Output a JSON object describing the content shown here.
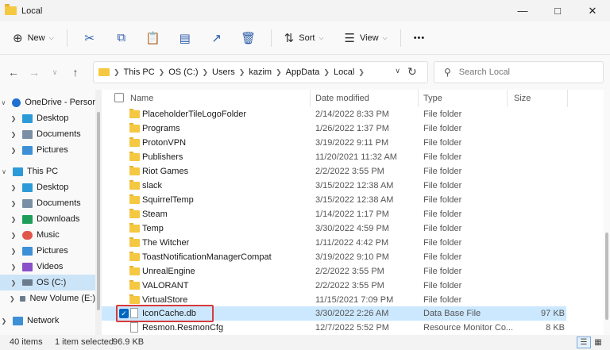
{
  "window": {
    "title": "Local"
  },
  "toolbar": {
    "new_label": "New",
    "sort_label": "Sort",
    "view_label": "View",
    "more_label": "•••"
  },
  "address": {
    "crumbs": [
      "This PC",
      "OS (C:)",
      "Users",
      "kazim",
      "AppData",
      "Local"
    ],
    "search_placeholder": "Search Local"
  },
  "sidebar": {
    "items": [
      {
        "label": "OneDrive - Persor",
        "icon": "cloud-icon",
        "color": "#1f6fd1",
        "expanded": true
      },
      {
        "label": "Desktop",
        "icon": "desktop-icon",
        "color": "#2d9ad8"
      },
      {
        "label": "Documents",
        "icon": "documents-icon",
        "color": "#7a8fa6"
      },
      {
        "label": "Pictures",
        "icon": "pictures-icon",
        "color": "#3d8fd6"
      },
      {
        "label": "This PC",
        "icon": "computer-icon",
        "color": "#2d9ad8",
        "expanded": true
      },
      {
        "label": "Desktop",
        "icon": "desktop-icon",
        "color": "#2d9ad8"
      },
      {
        "label": "Documents",
        "icon": "documents-icon",
        "color": "#7a8fa6"
      },
      {
        "label": "Downloads",
        "icon": "downloads-icon",
        "color": "#1e9e5a"
      },
      {
        "label": "Music",
        "icon": "music-icon",
        "color": "#e0574a"
      },
      {
        "label": "Pictures",
        "icon": "pictures-icon",
        "color": "#3d8fd6"
      },
      {
        "label": "Videos",
        "icon": "videos-icon",
        "color": "#8a4fc9"
      },
      {
        "label": "OS (C:)",
        "icon": "drive-icon",
        "color": "#6b7b8c",
        "selected": true
      },
      {
        "label": "New Volume (E:)",
        "icon": "drive-icon",
        "color": "#6b7b8c"
      },
      {
        "label": "Network",
        "icon": "network-icon",
        "color": "#3d8fd6"
      }
    ]
  },
  "columns": {
    "name": "Name",
    "date": "Date modified",
    "type": "Type",
    "size": "Size"
  },
  "files": [
    {
      "name": "PlaceholderTileLogoFolder",
      "date": "2/14/2022 8:33 PM",
      "type": "File folder",
      "size": ""
    },
    {
      "name": "Programs",
      "date": "1/26/2022 1:37 PM",
      "type": "File folder",
      "size": ""
    },
    {
      "name": "ProtonVPN",
      "date": "3/19/2022 9:11 PM",
      "type": "File folder",
      "size": ""
    },
    {
      "name": "Publishers",
      "date": "11/20/2021 11:32 AM",
      "type": "File folder",
      "size": ""
    },
    {
      "name": "Riot Games",
      "date": "2/2/2022 3:55 PM",
      "type": "File folder",
      "size": ""
    },
    {
      "name": "slack",
      "date": "3/15/2022 12:38 AM",
      "type": "File folder",
      "size": ""
    },
    {
      "name": "SquirrelTemp",
      "date": "3/15/2022 12:38 AM",
      "type": "File folder",
      "size": ""
    },
    {
      "name": "Steam",
      "date": "1/14/2022 1:17 PM",
      "type": "File folder",
      "size": ""
    },
    {
      "name": "Temp",
      "date": "3/30/2022 4:59 PM",
      "type": "File folder",
      "size": ""
    },
    {
      "name": "The Witcher",
      "date": "1/11/2022 4:42 PM",
      "type": "File folder",
      "size": ""
    },
    {
      "name": "ToastNotificationManagerCompat",
      "date": "3/19/2022 9:10 PM",
      "type": "File folder",
      "size": ""
    },
    {
      "name": "UnrealEngine",
      "date": "2/2/2022 3:55 PM",
      "type": "File folder",
      "size": ""
    },
    {
      "name": "VALORANT",
      "date": "2/2/2022 3:55 PM",
      "type": "File folder",
      "size": ""
    },
    {
      "name": "VirtualStore",
      "date": "11/15/2021 7:09 PM",
      "type": "File folder",
      "size": ""
    },
    {
      "name": "IconCache.db",
      "date": "3/30/2022 2:26 AM",
      "type": "Data Base File",
      "size": "97 KB",
      "selected": true
    },
    {
      "name": "Resmon.ResmonCfg",
      "date": "12/7/2022 5:52 PM",
      "type": "Resource Monitor Co...",
      "size": "8 KB"
    }
  ],
  "status": {
    "count": "40 items",
    "selection": "1 item selected",
    "selection_size": "96.9 KB"
  },
  "colors": {
    "selection": "#cce8ff",
    "accent": "#0067c0",
    "highlight": "#d83b3b"
  }
}
